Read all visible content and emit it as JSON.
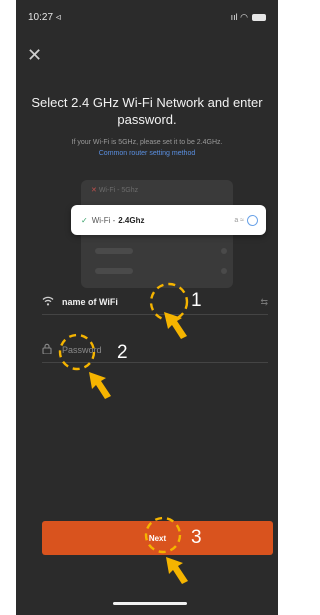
{
  "status_bar": {
    "time": "10:27 ◃",
    "signal": "ııl ◠"
  },
  "title": "Select 2.4 GHz Wi-Fi Network and enter password.",
  "hint": {
    "text": "If your Wi-Fi is 5GHz, please set it to be 2.4GHz.",
    "link": "Common router setting method"
  },
  "illustration": {
    "wifi_5g": "Wi-Fi - 5Ghz",
    "wifi_24_prefix": "Wi-Fi -",
    "wifi_24_ssid": "2.4Ghz",
    "wifi_icons": "a ≈"
  },
  "form": {
    "network_name": "name of WiFi",
    "password_placeholder": "Password",
    "switch_icon": "⇆"
  },
  "next_button": "Next",
  "annotations": [
    "1",
    "2",
    "3"
  ],
  "colors": {
    "background": "#2b2b2b",
    "accent": "#d9531e",
    "link": "#5a8fe0",
    "annotation": "#f5b400"
  }
}
